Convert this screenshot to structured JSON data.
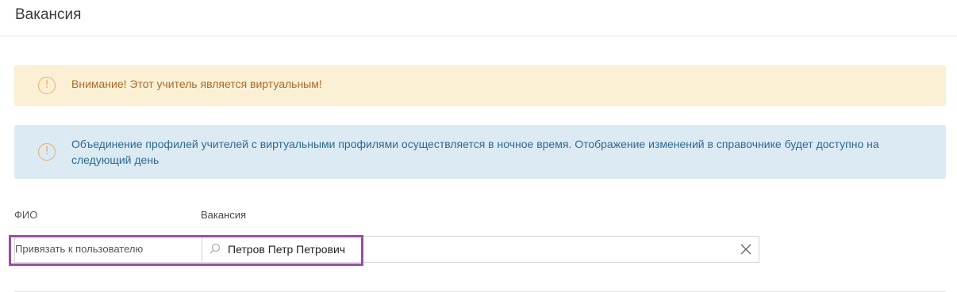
{
  "header": {
    "title": "Вакансия"
  },
  "alerts": {
    "warning": {
      "icon": "exclamation-circle-icon",
      "text": "Внимание! Этот учитель является виртуальным!",
      "color": "#a86a2a",
      "background": "#fbf0d4"
    },
    "info": {
      "icon": "exclamation-circle-icon",
      "text": "Объединение профилей учителей с виртуальными профилями осуществляется в ночное время. Отображение изменений в справочнике будет доступно на следующий день",
      "color": "#2d6a96",
      "background": "#dceaf3"
    }
  },
  "form": {
    "fio_label": "ФИО",
    "fio_value": "Вакансия",
    "bind_label": "Привязать к пользователю",
    "bind_value": "Петров Петр Петрович",
    "search_icon": "search-icon",
    "clear_icon": "close-icon"
  },
  "highlight_color": "#9b4ca8"
}
